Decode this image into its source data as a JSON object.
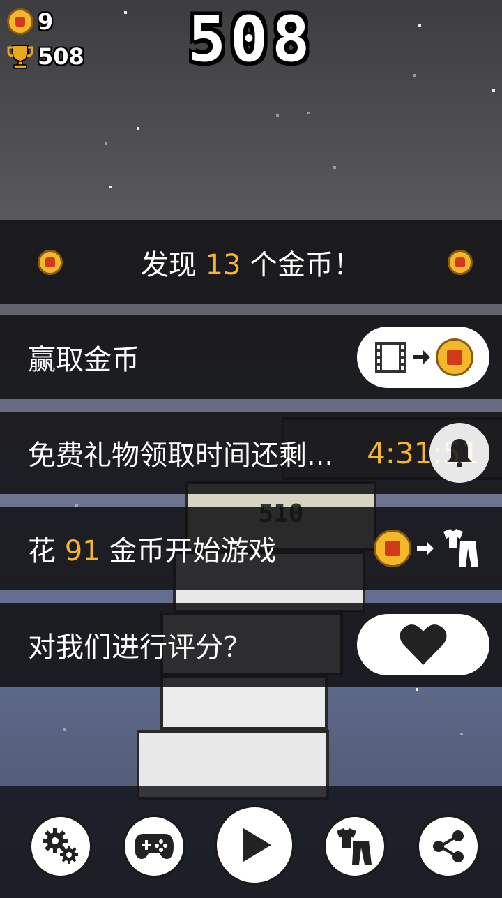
{
  "hud": {
    "coins": "9",
    "best": "508",
    "score": "508"
  },
  "found_banner": {
    "prefix": "发现",
    "count": "13",
    "suffix": "个金币！"
  },
  "menu": {
    "earn_coins": "赢取金币",
    "free_gift": "免费礼物领取时间还剩...",
    "free_gift_timer": "4:31:51",
    "spend_prefix": "花",
    "spend_amount": "91",
    "spend_suffix": "金币开始游戏",
    "rate": "对我们进行评分？"
  },
  "tower_label": "510",
  "colors": {
    "accent": "#f5b52d",
    "panel": "#121214",
    "coin": "#f2b82a"
  },
  "icons": [
    "coin-icon",
    "trophy-icon",
    "film-icon",
    "arrow-right-icon",
    "bell-icon",
    "shirt-pants-icon",
    "heart-icon",
    "gears-icon",
    "gamepad-icon",
    "play-icon",
    "share-icon"
  ]
}
